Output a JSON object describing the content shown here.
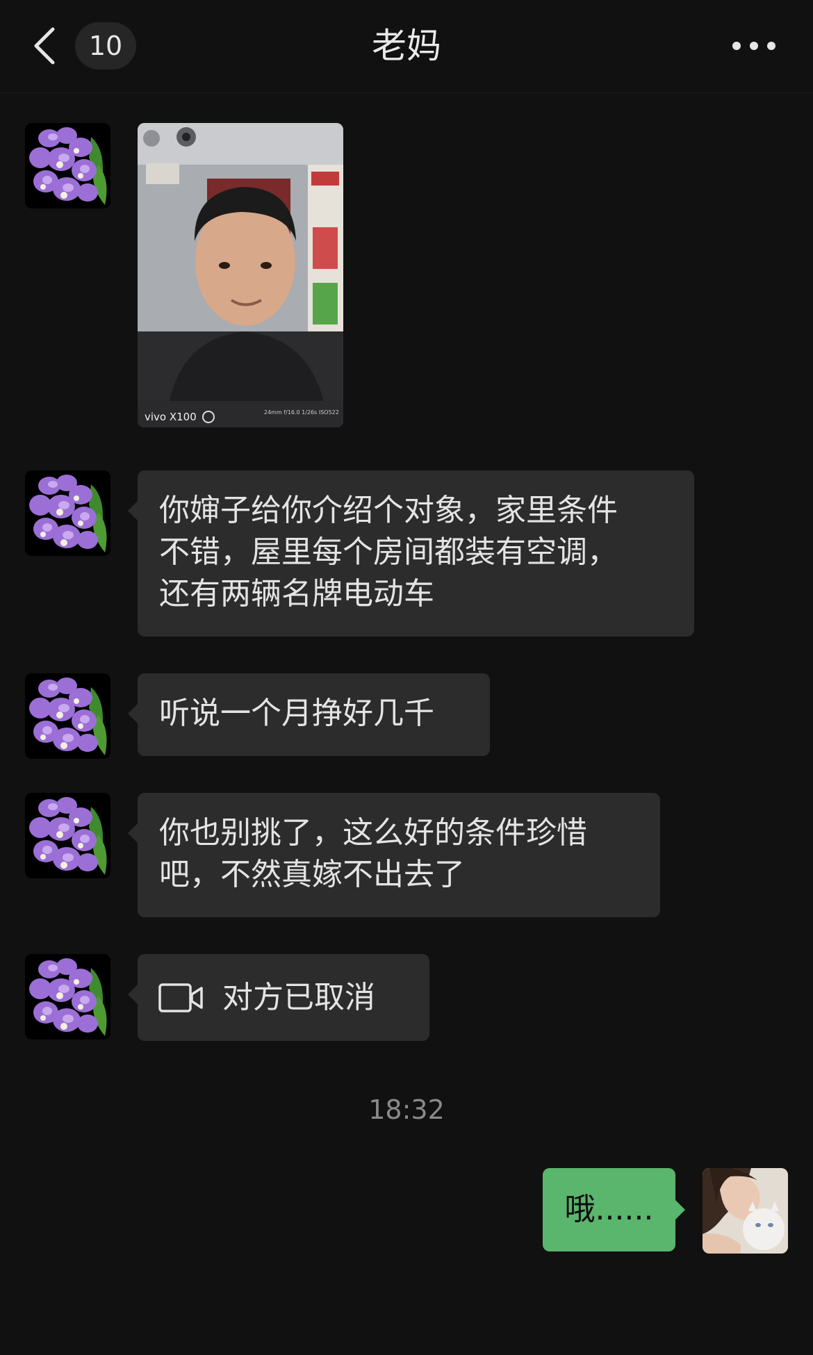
{
  "header": {
    "unread_count": "10",
    "title": "老妈"
  },
  "messages": [
    {
      "text": "你婶子给你介绍个对象，家里条件\n不错，屋里每个房间都装有空调，\n还有两辆名牌电动车"
    },
    {
      "text": "听说一个月挣好几千"
    },
    {
      "text": "你也别挑了，这么好的条件珍惜\n吧，不然真嫁不出去了"
    },
    {
      "text": "对方已取消"
    }
  ],
  "photo": {
    "brand_label": "vivo X100",
    "exif_label": "24mm f/16.0 1/26s ISO522"
  },
  "timestamp": "18:32",
  "my_message": "哦......",
  "colors": {
    "background": "#111111",
    "incoming_bubble": "#2c2c2c",
    "outgoing_bubble": "#5ab56d"
  }
}
